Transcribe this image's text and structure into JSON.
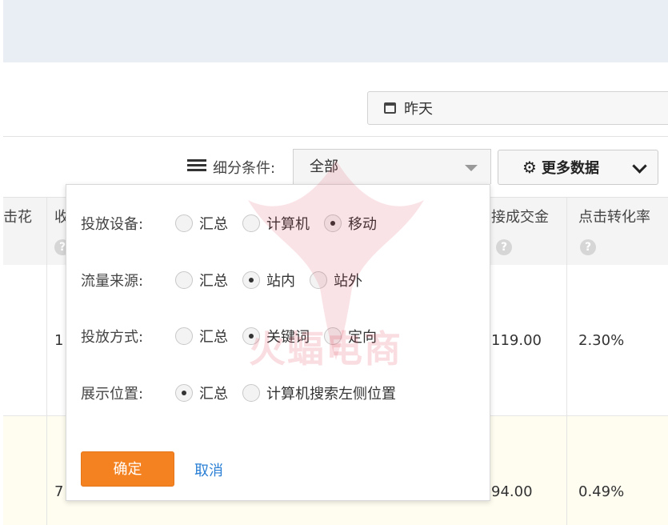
{
  "date_picker": {
    "label": "昨天",
    "icon": "calendar-icon"
  },
  "filter": {
    "label": "细分条件:",
    "value": "全部",
    "icon": "list-icon"
  },
  "more_data": {
    "label": "更多数据",
    "icon": "gear-icon"
  },
  "table": {
    "headers": [
      "击花",
      "收",
      "接成交金",
      "点击转化率"
    ],
    "help_icon": "?",
    "rows": [
      {
        "col1": "1",
        "amount": "119.00",
        "rate": "2.30%"
      },
      {
        "col1": "7",
        "amount": "94.00",
        "rate": "0.49%"
      }
    ]
  },
  "popup": {
    "groups": [
      {
        "label": "投放设备:",
        "options": [
          "汇总",
          "计算机",
          "移动"
        ],
        "selected": 2
      },
      {
        "label": "流量来源:",
        "options": [
          "汇总",
          "站内",
          "站外"
        ],
        "selected": 1
      },
      {
        "label": "投放方式:",
        "options": [
          "汇总",
          "关键词",
          "定向"
        ],
        "selected": 1
      },
      {
        "label": "展示位置:",
        "options": [
          "汇总",
          "计算机搜索左侧位置"
        ],
        "selected": 0
      }
    ],
    "confirm": "确定",
    "cancel": "取消"
  },
  "watermark": "火蝠电商",
  "colors": {
    "accent": "#f58220",
    "link": "#2a7fd4",
    "topbar": "#e8eef4"
  }
}
